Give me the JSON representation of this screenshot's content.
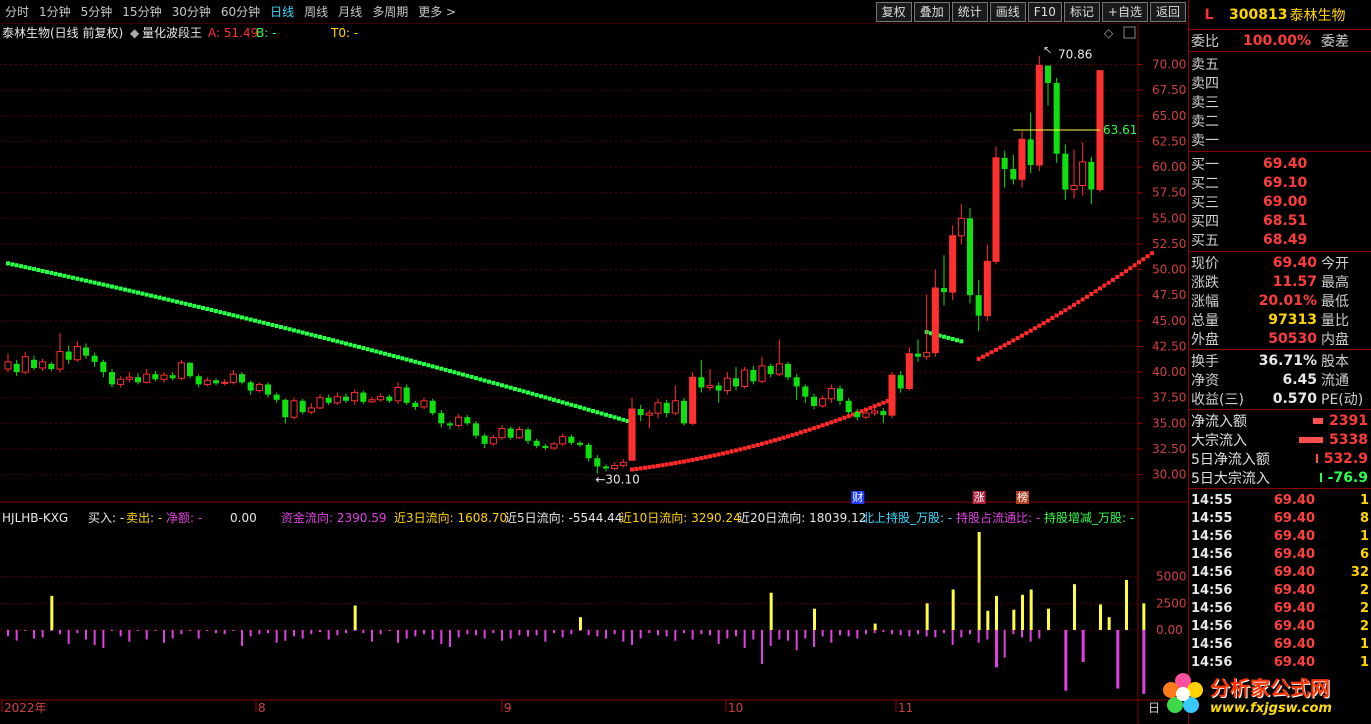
{
  "toolbar": {
    "periods": [
      "分时",
      "1分钟",
      "5分钟",
      "15分钟",
      "30分钟",
      "60分钟",
      "日线",
      "周线",
      "月线",
      "多周期",
      "更多 >"
    ],
    "active_period": "日线",
    "buttons": [
      "复权",
      "叠加",
      "统计",
      "画线",
      "F10",
      "标记",
      "+自选",
      "返回"
    ]
  },
  "chart_header": {
    "stock": "泰林生物(日线 前复权)",
    "indicator": "量化波段王",
    "a_label": "A: 51.49",
    "b_label": "B: -",
    "t0_label": "T0: -"
  },
  "price_axis": [
    "70.00",
    "67.50",
    "65.00",
    "62.50",
    "60.00",
    "57.50",
    "55.00",
    "52.50",
    "50.00",
    "47.50",
    "45.00",
    "42.50",
    "40.00",
    "37.50",
    "35.00",
    "32.50",
    "30.00"
  ],
  "annotations": {
    "high": "70.86",
    "low": "30.10",
    "mid": "63.61"
  },
  "event_markers": [
    "财",
    "涨",
    "榜"
  ],
  "sub_header": {
    "name": "HJLHB-KXG",
    "buy": "买入: -",
    "sell": "卖出: -",
    "net": "净额: -",
    "net_val": "0.00",
    "flow": "资金流向: 2390.59",
    "flow3": "近3日流向: 1608.70",
    "flow5": "近5日流向: -5544.44",
    "flow10": "近10日流向: 3290.24",
    "flow20": "近20日流向: 18039.12",
    "north": "北上持股_万股: -",
    "hold_ratio": "持股占流通比: -",
    "hold_chg": "持股增减_万股: -"
  },
  "sub_axis": [
    "5000",
    "2500",
    "0.00"
  ],
  "date_axis": [
    "2022年",
    "8",
    "9",
    "10",
    "11"
  ],
  "date_corner": "日",
  "quote": {
    "L": "L",
    "code": "300813",
    "name": "泰林生物",
    "weibi_label": "委比",
    "weibi_val": "100.00%",
    "weicha_label": "委差",
    "sells": [
      "卖五",
      "卖四",
      "卖三",
      "卖二",
      "卖一"
    ],
    "buys": [
      {
        "label": "买一",
        "price": "69.40"
      },
      {
        "label": "买二",
        "price": "69.10"
      },
      {
        "label": "买三",
        "price": "69.00"
      },
      {
        "label": "买四",
        "price": "68.51"
      },
      {
        "label": "买五",
        "price": "68.49"
      }
    ],
    "stats": [
      {
        "l": "现价",
        "v": "69.40",
        "r": "今开",
        "c": "red"
      },
      {
        "l": "涨跌",
        "v": "11.57",
        "r": "最高",
        "c": "red"
      },
      {
        "l": "涨幅",
        "v": "20.01%",
        "r": "最低",
        "c": "red"
      },
      {
        "l": "总量",
        "v": "97313",
        "r": "量比",
        "c": "yellow"
      },
      {
        "l": "外盘",
        "v": "50530",
        "r": "内盘",
        "c": "red"
      }
    ],
    "stats2": [
      {
        "l": "换手",
        "v": "36.71%",
        "r": "股本"
      },
      {
        "l": "净资",
        "v": "6.45",
        "r": "流通"
      },
      {
        "l": "收益(三)",
        "v": "0.570",
        "r": "PE(动)"
      }
    ],
    "flows": [
      {
        "l": "净流入额",
        "v": "2391",
        "c": "red",
        "bar": 10
      },
      {
        "l": "大宗流入",
        "v": "5338",
        "c": "red",
        "bar": 24
      },
      {
        "l": "5日净流入额",
        "v": "532.9",
        "c": "red",
        "bar": 0
      },
      {
        "l": "5日大宗流入",
        "v": "-76.9",
        "c": "green",
        "bar": 0
      }
    ],
    "ticks": [
      {
        "t": "14:55",
        "p": "69.40",
        "v": "1"
      },
      {
        "t": "14:55",
        "p": "69.40",
        "v": "8"
      },
      {
        "t": "14:56",
        "p": "69.40",
        "v": "1"
      },
      {
        "t": "14:56",
        "p": "69.40",
        "v": "6"
      },
      {
        "t": "14:56",
        "p": "69.40",
        "v": "32"
      },
      {
        "t": "14:56",
        "p": "69.40",
        "v": "2"
      },
      {
        "t": "14:56",
        "p": "69.40",
        "v": "2"
      },
      {
        "t": "14:56",
        "p": "69.40",
        "v": "2"
      },
      {
        "t": "14:56",
        "p": "69.40",
        "v": "1"
      },
      {
        "t": "14:56",
        "p": "69.40",
        "v": "1"
      }
    ]
  },
  "logo": {
    "cn": "分析家公式网",
    "url": "www.fxjgsw.com"
  },
  "colors": {
    "up": "#ff3030",
    "down": "#10e010",
    "band_green": "#2aff4a",
    "band_red": "#ff2a2a",
    "axis": "#8a0000",
    "yellow": "#ffff40",
    "magenta": "#e040e0"
  },
  "chart_data": {
    "type": "candlestick",
    "y_range": [
      28.5,
      72.0
    ],
    "candles": [
      [
        40.3,
        41.0,
        41.8,
        40.0
      ],
      [
        40.8,
        40.0,
        41.2,
        39.6
      ],
      [
        40.0,
        41.5,
        42.0,
        39.8
      ],
      [
        41.2,
        40.4,
        41.6,
        40.2
      ],
      [
        40.4,
        41.0,
        41.3,
        40.1
      ],
      [
        40.8,
        40.3,
        41.0,
        40.1
      ],
      [
        40.3,
        42.0,
        43.8,
        40.0
      ],
      [
        42.0,
        41.2,
        42.6,
        40.8
      ],
      [
        41.2,
        42.5,
        43.0,
        41.0
      ],
      [
        42.4,
        41.6,
        42.8,
        41.3
      ],
      [
        41.6,
        41.0,
        41.9,
        40.5
      ],
      [
        41.0,
        40.0,
        41.2,
        39.5
      ],
      [
        40.0,
        38.8,
        40.3,
        38.5
      ],
      [
        38.8,
        39.3,
        39.6,
        38.5
      ],
      [
        39.3,
        39.5,
        40.0,
        39.0
      ],
      [
        39.5,
        39.0,
        39.9,
        38.8
      ],
      [
        39.0,
        39.8,
        40.3,
        38.9
      ],
      [
        39.8,
        39.3,
        40.1,
        39.1
      ],
      [
        39.3,
        39.7,
        40.0,
        39.0
      ],
      [
        39.7,
        39.4,
        40.0,
        39.2
      ],
      [
        39.4,
        40.9,
        41.2,
        39.2
      ],
      [
        40.9,
        39.6,
        41.0,
        39.4
      ],
      [
        39.6,
        38.8,
        39.8,
        38.5
      ],
      [
        38.8,
        39.2,
        39.5,
        38.6
      ],
      [
        39.2,
        38.9,
        39.4,
        38.7
      ],
      [
        38.9,
        39.0,
        39.3,
        38.7
      ],
      [
        39.0,
        39.8,
        40.2,
        38.8
      ],
      [
        39.8,
        39.0,
        40.0,
        38.8
      ],
      [
        39.0,
        38.2,
        39.2,
        37.8
      ],
      [
        38.2,
        38.8,
        39.0,
        38.0
      ],
      [
        38.8,
        37.8,
        39.0,
        37.5
      ],
      [
        37.8,
        37.3,
        38.0,
        37.0
      ],
      [
        37.3,
        35.6,
        37.4,
        35.0
      ],
      [
        35.6,
        37.2,
        37.5,
        35.4
      ],
      [
        37.2,
        36.1,
        37.4,
        35.9
      ],
      [
        36.1,
        36.5,
        37.0,
        35.9
      ],
      [
        36.5,
        37.5,
        37.8,
        36.4
      ],
      [
        37.5,
        37.0,
        37.8,
        36.8
      ],
      [
        37.0,
        37.6,
        38.0,
        36.8
      ],
      [
        37.6,
        37.2,
        37.9,
        37.0
      ],
      [
        37.2,
        38.0,
        38.3,
        36.8
      ],
      [
        38.0,
        37.1,
        38.2,
        36.9
      ],
      [
        37.1,
        37.3,
        37.6,
        37.0
      ],
      [
        37.3,
        37.6,
        37.9,
        37.1
      ],
      [
        37.6,
        37.2,
        37.8,
        37.0
      ],
      [
        37.2,
        38.5,
        39.0,
        36.9
      ],
      [
        38.5,
        37.0,
        38.8,
        36.8
      ],
      [
        37.0,
        36.6,
        37.2,
        36.3
      ],
      [
        36.6,
        37.2,
        37.5,
        36.4
      ],
      [
        37.2,
        36.0,
        37.4,
        35.8
      ],
      [
        36.0,
        35.0,
        36.3,
        34.6
      ],
      [
        35.0,
        34.8,
        35.2,
        34.4
      ],
      [
        34.8,
        35.6,
        35.9,
        34.6
      ],
      [
        35.6,
        35.0,
        35.8,
        34.8
      ],
      [
        35.0,
        33.8,
        35.2,
        33.5
      ],
      [
        33.8,
        33.0,
        34.0,
        32.6
      ],
      [
        33.0,
        33.6,
        33.9,
        32.8
      ],
      [
        33.6,
        34.5,
        34.8,
        33.4
      ],
      [
        34.5,
        33.6,
        34.7,
        33.4
      ],
      [
        33.6,
        34.4,
        34.7,
        33.5
      ],
      [
        34.4,
        33.3,
        34.6,
        33.0
      ],
      [
        33.3,
        32.8,
        33.5,
        32.6
      ],
      [
        32.8,
        32.6,
        33.0,
        32.4
      ],
      [
        32.6,
        33.0,
        33.2,
        32.4
      ],
      [
        33.0,
        33.7,
        34.0,
        32.8
      ],
      [
        33.7,
        33.1,
        33.9,
        32.9
      ],
      [
        33.1,
        32.9,
        33.3,
        32.7
      ],
      [
        32.9,
        31.6,
        33.1,
        31.3
      ],
      [
        31.6,
        30.8,
        31.9,
        30.1
      ],
      [
        30.8,
        30.6,
        31.0,
        30.3
      ],
      [
        30.6,
        30.9,
        31.2,
        30.4
      ],
      [
        30.9,
        31.2,
        31.5,
        30.7
      ],
      [
        31.4,
        36.4,
        37.5,
        32.3
      ],
      [
        36.4,
        35.8,
        36.8,
        35.2
      ],
      [
        35.8,
        36.0,
        36.3,
        34.5
      ],
      [
        36.0,
        37.0,
        37.4,
        35.5
      ],
      [
        37.0,
        36.0,
        37.3,
        35.6
      ],
      [
        36.0,
        37.2,
        38.7,
        35.8
      ],
      [
        37.2,
        35.0,
        37.5,
        34.8
      ],
      [
        35.0,
        39.5,
        40.0,
        34.8
      ],
      [
        39.5,
        38.5,
        41.2,
        38.0
      ],
      [
        38.5,
        38.7,
        40.3,
        38.2
      ],
      [
        38.7,
        38.2,
        39.0,
        37.0
      ],
      [
        38.2,
        39.4,
        40.0,
        37.8
      ],
      [
        39.4,
        38.6,
        40.5,
        38.2
      ],
      [
        38.6,
        40.2,
        40.5,
        38.4
      ],
      [
        40.2,
        39.1,
        40.6,
        38.8
      ],
      [
        39.1,
        40.6,
        41.5,
        38.9
      ],
      [
        40.6,
        39.8,
        40.8,
        39.5
      ],
      [
        39.8,
        40.8,
        43.2,
        39.6
      ],
      [
        40.8,
        39.5,
        41.0,
        39.2
      ],
      [
        39.5,
        38.6,
        39.8,
        37.3
      ],
      [
        38.6,
        37.6,
        38.8,
        37.0
      ],
      [
        37.6,
        36.7,
        37.9,
        36.4
      ],
      [
        36.7,
        37.4,
        37.7,
        36.5
      ],
      [
        37.4,
        38.4,
        38.8,
        37.0
      ],
      [
        38.4,
        37.2,
        38.7,
        36.8
      ],
      [
        37.2,
        36.1,
        37.5,
        35.9
      ],
      [
        36.1,
        35.6,
        36.4,
        35.3
      ],
      [
        35.6,
        36.0,
        36.3,
        35.4
      ],
      [
        36.0,
        36.2,
        36.5,
        35.7
      ],
      [
        36.2,
        35.8,
        36.5,
        35.0
      ],
      [
        35.8,
        39.7,
        40.0,
        35.5
      ],
      [
        39.7,
        38.4,
        40.1,
        38.0
      ],
      [
        38.4,
        41.8,
        42.4,
        38.2
      ],
      [
        41.8,
        41.5,
        43.2,
        41.0
      ],
      [
        41.5,
        41.9,
        47.6,
        41.2
      ],
      [
        41.9,
        48.2,
        50.0,
        41.5
      ],
      [
        48.2,
        47.8,
        51.4,
        46.5
      ],
      [
        47.8,
        53.3,
        54.3,
        47.0
      ],
      [
        53.3,
        55.0,
        56.4,
        52.5
      ],
      [
        55.0,
        47.5,
        56.0,
        46.7
      ],
      [
        47.5,
        45.5,
        49.0,
        44.0
      ],
      [
        45.5,
        50.8,
        52.4,
        45.0
      ],
      [
        50.8,
        60.9,
        62.0,
        50.5
      ],
      [
        60.9,
        59.8,
        61.6,
        58.0
      ],
      [
        59.8,
        58.8,
        61.2,
        58.3
      ],
      [
        58.8,
        62.7,
        63.5,
        58.0
      ],
      [
        62.7,
        60.2,
        65.3,
        59.4
      ],
      [
        60.2,
        69.9,
        70.86,
        59.6
      ],
      [
        69.9,
        68.2,
        69.9,
        66.0
      ],
      [
        68.2,
        61.3,
        68.7,
        60.4
      ],
      [
        61.3,
        57.8,
        62.2,
        56.8
      ],
      [
        57.8,
        58.2,
        61.7,
        56.9
      ],
      [
        58.2,
        60.5,
        62.4,
        57.2
      ],
      [
        60.5,
        57.8,
        61.0,
        56.4
      ],
      [
        57.8,
        69.4,
        69.4,
        57.6
      ]
    ],
    "band_green_start": 50.6,
    "band_green_end": 35.1,
    "band_green2": [
      43.9,
      43.0
    ],
    "band_red_start": 30.5,
    "band_red_end": 51.6,
    "sub_range": [
      -6200,
      9200
    ],
    "sub_bars": [
      -600,
      -1000,
      200,
      -800,
      -700,
      3200,
      -400,
      -1300,
      -300,
      -900,
      -1400,
      -1700,
      1200,
      -600,
      -1100,
      1400,
      -900,
      300,
      -1200,
      -800,
      -400,
      1300,
      -800,
      200,
      -300,
      -400,
      900,
      -1500,
      -600,
      -400,
      -300,
      -1200,
      -1000,
      -600,
      -800,
      -400,
      -200,
      -900,
      -500,
      -300,
      2300,
      -300,
      -1100,
      -400,
      300,
      -1200,
      -800,
      -600,
      -400,
      -900,
      -1300,
      -1600,
      -700,
      -400,
      -500,
      -800,
      -300,
      -1000,
      -800,
      -500,
      -600,
      -500,
      -1100,
      -300,
      -700,
      -400,
      1200,
      -500,
      -600,
      -800,
      -400,
      -1100,
      -1400,
      -800,
      -300,
      -500,
      -600,
      -1000,
      -300,
      -900,
      -400,
      -500,
      -1300,
      -800,
      -600,
      -1700,
      -900,
      -3200,
      -1500,
      -900,
      -1000,
      -1900,
      -800,
      -1600,
      -600,
      -1200,
      -500,
      -600,
      -800,
      -400,
      -300,
      -200,
      -400,
      -500,
      -600,
      -400,
      -600,
      -700,
      -300,
      -1400,
      -700,
      -400,
      -1200,
      -900,
      -300,
      -2600,
      -400,
      -700,
      -1100,
      -800
    ],
    "sub_pos": [
      {
        "i": 5,
        "v": 3200
      },
      {
        "i": 40,
        "v": 2300
      },
      {
        "i": 66,
        "v": 1200
      },
      {
        "i": 88,
        "v": 3500
      },
      {
        "i": 93,
        "v": 2000
      },
      {
        "i": 100,
        "v": 600
      },
      {
        "i": 106,
        "v": 2500
      },
      {
        "i": 109,
        "v": 3800
      },
      {
        "i": 112,
        "v": 9200
      },
      {
        "i": 113,
        "v": 1800
      },
      {
        "i": 114,
        "v": 3200
      },
      {
        "i": 116,
        "v": 1900
      },
      {
        "i": 117,
        "v": 3300
      },
      {
        "i": 118,
        "v": 3800
      },
      {
        "i": 120,
        "v": 2000
      },
      {
        "i": 123,
        "v": 4300
      },
      {
        "i": 126,
        "v": 2400
      },
      {
        "i": 127,
        "v": 1200
      },
      {
        "i": 129,
        "v": 4700
      },
      {
        "i": 131,
        "v": 2500
      }
    ],
    "sub_neg_big": [
      {
        "i": 114,
        "v": -3500
      },
      {
        "i": 122,
        "v": -5700
      },
      {
        "i": 124,
        "v": -3000
      },
      {
        "i": 128,
        "v": -5500
      },
      {
        "i": 131,
        "v": -6000
      }
    ]
  }
}
